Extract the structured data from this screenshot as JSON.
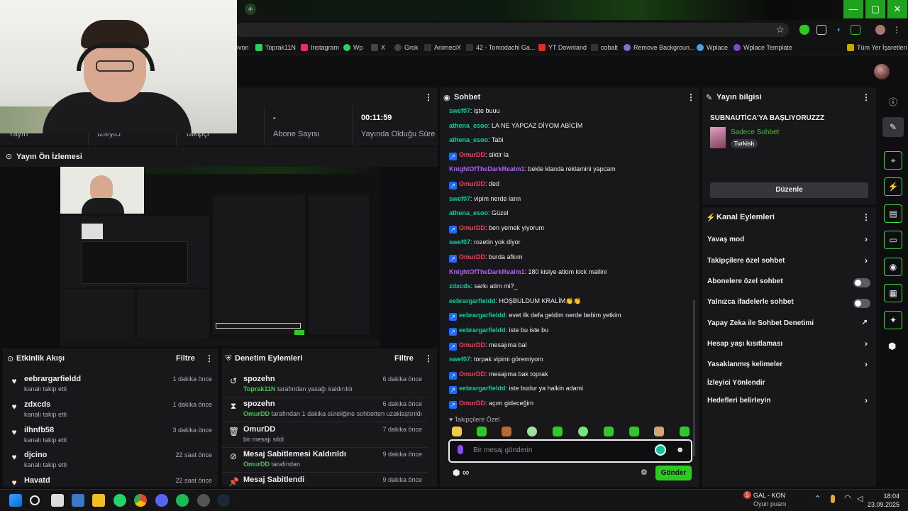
{
  "browser": {
    "new_tab": "+",
    "bookmarks": [
      {
        "label": "ivon",
        "color": "#4a8f3a"
      },
      {
        "label": "Toprak11N",
        "color": "#2bcc5c"
      },
      {
        "label": "Instagram",
        "color": "#e1306c"
      },
      {
        "label": "Wp",
        "color": "#25d366"
      },
      {
        "label": "X",
        "color": "#cccccc"
      },
      {
        "label": "Grok",
        "color": "#cccccc"
      },
      {
        "label": "AnimeciX",
        "color": "#cccccc"
      },
      {
        "label": "42 - Tomodachi Ga...",
        "color": "#cccccc"
      },
      {
        "label": "YT Downland",
        "color": "#d93025"
      },
      {
        "label": "cobalt",
        "color": "#cccccc"
      },
      {
        "label": "Remove Backgroun...",
        "color": "#8c6ad6"
      },
      {
        "label": "Wplace",
        "color": "#4a9fe0"
      },
      {
        "label": "Wplace Template",
        "color": "#7d4ad6"
      }
    ],
    "all_bookmarks": "Tüm Yer İşaretleri",
    "window_buttons": [
      "—",
      "▢",
      "✕"
    ]
  },
  "stats": {
    "items": [
      {
        "value": "",
        "label": "Yayın"
      },
      {
        "value": "",
        "label": "İzleyici"
      },
      {
        "value": "",
        "label": "Takipçi"
      },
      {
        "value": "-",
        "label": "Abone Sayısı"
      },
      {
        "value": "00:11:59",
        "label": "Yayında Olduğu Süre"
      }
    ]
  },
  "preview": {
    "title": "Yayın Ön İzlemesi"
  },
  "activity": {
    "title": "Etkinlik Akışı",
    "filter": "Filtre",
    "items": [
      {
        "user": "eebrargarfieldd",
        "action": "kanalı takip etti",
        "time": "1 dakika önce"
      },
      {
        "user": "zdxcds",
        "action": "kanalı takip etti",
        "time": "1 dakika önce"
      },
      {
        "user": "ilhnfb58",
        "action": "kanalı takip etti",
        "time": "3 dakika önce"
      },
      {
        "user": "djcino",
        "action": "kanalı takip etti",
        "time": "22 saat önce"
      },
      {
        "user": "Havatd",
        "action": "",
        "time": "22 saat önce"
      }
    ]
  },
  "moderation": {
    "title": "Denetim Eylemleri",
    "filter": "Filtre",
    "items": [
      {
        "title": "spozehn",
        "actor": "Toprak11N",
        "rest": "tarafından yasağı kaldırıldı",
        "time": "6 dakika önce",
        "icon": "↺"
      },
      {
        "title": "spozehn",
        "actor": "OmurDD",
        "rest": "tarafından 1 dakika süreliğine sohbetten uzaklaştırıldı",
        "time": "6 dakika önce",
        "icon": "⧗"
      },
      {
        "title": "OmurDD",
        "actor": "",
        "rest": "bir mesajı sildi",
        "time": "7 dakika önce",
        "icon": "🗑"
      },
      {
        "title": "Mesaj Sabitlemesi Kaldırıldı",
        "actor": "OmurDD",
        "rest": "tarafından",
        "time": "9 dakika önce",
        "icon": "⊘"
      },
      {
        "title": "Mesaj Sabitlendi",
        "actor": "",
        "rest": "",
        "time": "9 dakika önce",
        "icon": "📌"
      }
    ]
  },
  "chat": {
    "title": "Sohbet",
    "messages": [
      {
        "user": "swef07",
        "color": "#00d1a0",
        "text": "işte buuu",
        "badge": false
      },
      {
        "user": "athena_esoo",
        "color": "#00d1a0",
        "text": "LA NE YAPCAZ DİYOM ABİCİM",
        "badge": false
      },
      {
        "user": "athena_esoo",
        "color": "#00d1a0",
        "text": "Tabi",
        "badge": false
      },
      {
        "user": "OmurDD",
        "color": "#ff3b5c",
        "text": "siktir la",
        "badge": true
      },
      {
        "user": "KnightOfTheDarkRealm1",
        "color": "#b55cff",
        "text": "bekle klanda reklamini yapcam",
        "badge": false
      },
      {
        "user": "OmurDD",
        "color": "#ff3b5c",
        "text": "ded",
        "badge": true
      },
      {
        "user": "swef07",
        "color": "#00d1a0",
        "text": "vipim nerde lann",
        "badge": false
      },
      {
        "user": "athena_esoo",
        "color": "#00d1a0",
        "text": "Güzel",
        "badge": false
      },
      {
        "user": "OmurDD",
        "color": "#ff3b5c",
        "text": "ben yemek yiyorum",
        "badge": true
      },
      {
        "user": "swef07",
        "color": "#00d1a0",
        "text": "rozetin yok diyor",
        "badge": false
      },
      {
        "user": "OmurDD",
        "color": "#ff3b5c",
        "text": "burda afkım",
        "badge": true
      },
      {
        "user": "KnightOfTheDarkRealm1",
        "color": "#b55cff",
        "text": "180 kisiye atiom kick mailini",
        "badge": false
      },
      {
        "user": "zdxcds",
        "color": "#00d1a0",
        "text": "sarkı atim mi?_",
        "badge": false
      },
      {
        "user": "eebrargarfieldd",
        "color": "#00d1a0",
        "text": "HOŞBULDUM KRALİM👏👏",
        "badge": false
      },
      {
        "user": "eebrargarfieldd",
        "color": "#00d1a0",
        "text": "evet ilk defa geldim nerde bebim yetkim",
        "badge": true
      },
      {
        "user": "eebrargarfieldd",
        "color": "#00d1a0",
        "text": "iste bu iste bu",
        "badge": true
      },
      {
        "user": "OmurDD",
        "color": "#ff3b5c",
        "text": "mesajıma bal",
        "badge": true
      },
      {
        "user": "swef07",
        "color": "#00d1a0",
        "text": "torpak vipimi göremiyom",
        "badge": false
      },
      {
        "user": "OmurDD",
        "color": "#ff3b5c",
        "text": "mesajıma bak toprak",
        "badge": true
      },
      {
        "user": "eebrargarfieldd",
        "color": "#00d1a0",
        "text": "iste budur ya halkin adami",
        "badge": true
      },
      {
        "user": "OmurDD",
        "color": "#ff3b5c",
        "text": "açım gideceğim",
        "badge": true
      }
    ],
    "followers_only": "♥ Takipçilere Özel",
    "input_placeholder": "Bir mesaj gönderin",
    "send": "Gönder"
  },
  "stream_info": {
    "title": "Yayın bilgisi",
    "stream_title": "SUBNAUTİCA'YA BAŞLIYORUZZZ",
    "category": "Sadece Sohbet",
    "tag": "Turkish",
    "edit": "Düzenle"
  },
  "channel_actions": {
    "title": "Kanal Eylemleri",
    "items": [
      {
        "label": "Yavaş mod",
        "kind": "chevron"
      },
      {
        "label": "Takipçilere özel sohbet",
        "kind": "chevron"
      },
      {
        "label": "Abonelere özel sohbet",
        "kind": "toggle"
      },
      {
        "label": "Yalnızca ifadelerle sohbet",
        "kind": "toggle"
      },
      {
        "label": "Yapay Zeka ile Sohbet Denetimi",
        "kind": "external"
      },
      {
        "label": "Hesap yaşı kısıtlaması",
        "kind": "chevron"
      },
      {
        "label": "Yasaklanmış kelimeler",
        "kind": "chevron"
      },
      {
        "label": "İzleyici Yönlendir",
        "kind": "none"
      },
      {
        "label": "Hedefleri belirleyin",
        "kind": "chevron"
      }
    ]
  },
  "taskbar": {
    "game_badge": "5",
    "game_title": "GAL - KON",
    "game_sub": "Oyun puanı",
    "time": "18:04",
    "date": "23.09.2025"
  },
  "colors": {
    "accent": "#2bcc1f",
    "panel": "#18181b",
    "bg": "#0e0e10"
  }
}
